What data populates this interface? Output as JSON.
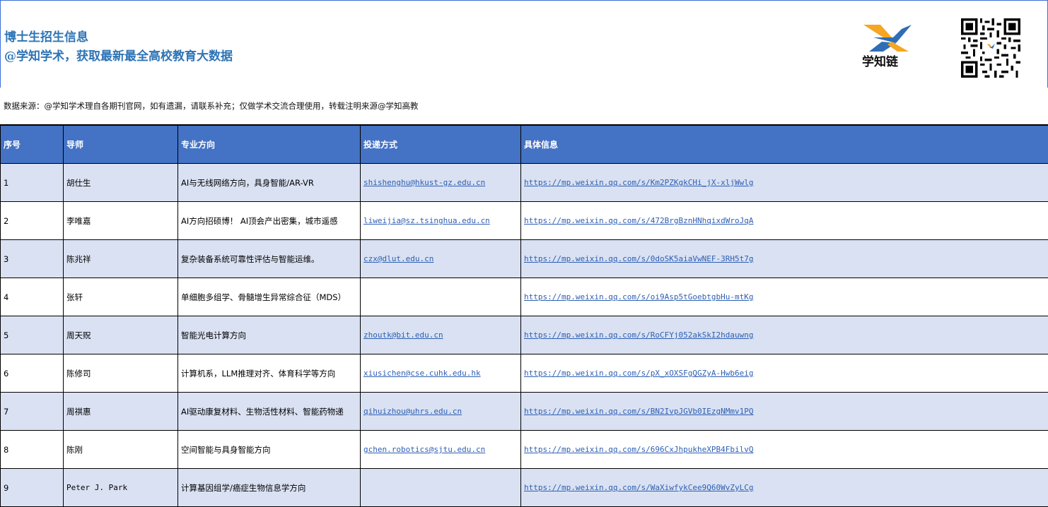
{
  "header": {
    "title": "博士生招生信息",
    "subtitle": "@学知学术，获取最新最全高校教育大数据",
    "logo_text": "学知链"
  },
  "source_note": "数据来源：@学知学术理自各期刊官网，如有遗漏，请联系补充；仅做学术交流合理使用，转载注明来源@学知高教",
  "table": {
    "columns": [
      "序号",
      "导师",
      "专业方向",
      "投递方式",
      "具体信息"
    ],
    "rows": [
      {
        "no": "1",
        "advisor": "胡仕生",
        "field": "AI与无线网络方向，具身智能/AR-VR",
        "email": "shishenghu@hkust-gz.edu.cn",
        "url": "https://mp.weixin.qq.com/s/Km2PZKgkCHi_jX-xljWwlg"
      },
      {
        "no": "2",
        "advisor": "李唯嘉",
        "field": "AI方向招硕博！  AI顶会产出密集，城市遥感",
        "email": "liweijia@sz.tsinghua.edu.cn",
        "url": "https://mp.weixin.qq.com/s/472BrgBznHNhqixdWroJqA"
      },
      {
        "no": "3",
        "advisor": "陈兆祥",
        "field": "复杂装备系统可靠性评估与智能运维。",
        "email": "czx@dlut.edu.cn",
        "url": "https://mp.weixin.qq.com/s/0doSK5aiaVwNEF-3RH5t7g"
      },
      {
        "no": "4",
        "advisor": "张轩",
        "field": "单细胞多组学、骨髓增生异常综合征（MDS）",
        "email": "",
        "url": "https://mp.weixin.qq.com/s/oi9Asp5tGoebtgbHu-mtKg"
      },
      {
        "no": "5",
        "advisor": "周天贶",
        "field": "智能光电计算方向",
        "email": "zhoutk@bit.edu.cn",
        "url": "https://mp.weixin.qq.com/s/RoCFYj052akSkI2hdauwng"
      },
      {
        "no": "6",
        "advisor": "陈修司",
        "field": "计算机系，LLM推理对齐、体育科学等方向",
        "email": "xiusichen@cse.cuhk.edu.hk",
        "url": "https://mp.weixin.qq.com/s/pX_xOXSFgQGZyA-Hwb6eig"
      },
      {
        "no": "7",
        "advisor": "周祺惠",
        "field": "AI驱动康复材料、生物活性材料、智能药物递",
        "email": "qihuizhou@uhrs.edu.cn",
        "url": "https://mp.weixin.qq.com/s/BN2IvpJGVb0IEzgNMmv1PQ"
      },
      {
        "no": "8",
        "advisor": "陈刚",
        "field": "空间智能与具身智能方向",
        "email": "gchen.robotics@sjtu.edu.cn",
        "url": "https://mp.weixin.qq.com/s/696CxJhpukheXPB4FbilvQ"
      },
      {
        "no": "9",
        "advisor": "Peter J. Park",
        "field": "计算基因组学/癌症生物信息学方向",
        "email": "",
        "url": "https://mp.weixin.qq.com/s/WaXiwfykCee9Q60WvZyLCg"
      }
    ]
  },
  "colors": {
    "header_blue": "#4472c4",
    "stripe": "#d9e1f2",
    "title_blue": "#2e74b5",
    "link": "#2e5fb3"
  },
  "icons": {
    "logo": "xuezhilian-logo",
    "qr": "qr-code"
  }
}
